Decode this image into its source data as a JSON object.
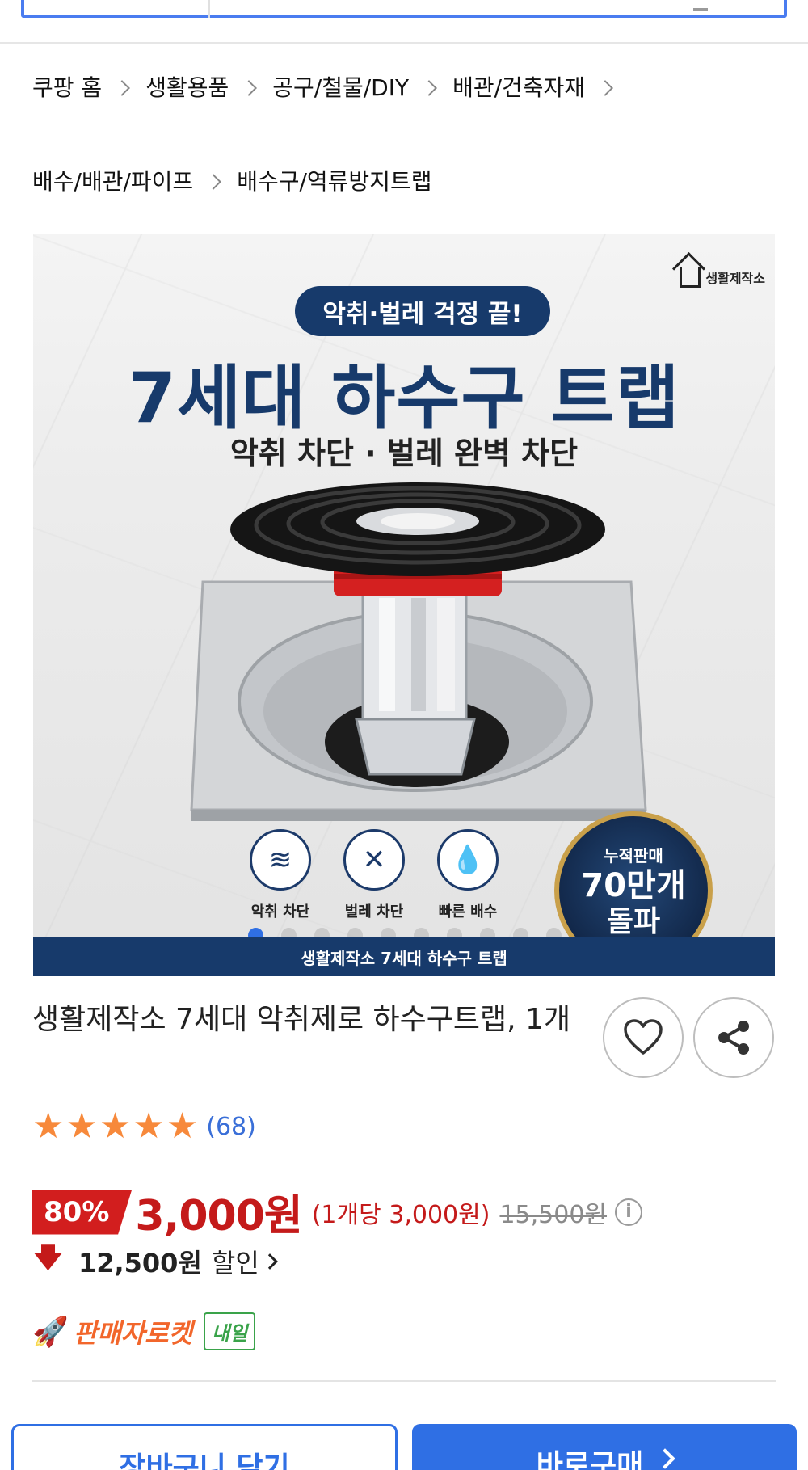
{
  "breadcrumb": {
    "items": [
      "쿠팡 홈",
      "생활용품",
      "공구/철물/DIY",
      "배관/건축자재",
      "배수/배관/파이프",
      "배수구/역류방지트랩"
    ]
  },
  "hero": {
    "brand_logo": "생활제작소",
    "pill": "악취·벌레 걱정 끝!",
    "headline": "7세대 하수구 트랩",
    "subline": "악취 차단 · 벌레 완벽 차단",
    "features": [
      {
        "label": "악취 차단",
        "icon": "odor-icon"
      },
      {
        "label": "벌레 차단",
        "icon": "bug-block-icon"
      },
      {
        "label": "빠른 배수",
        "icon": "water-drop-icon"
      }
    ],
    "seal": {
      "line1": "누적판매",
      "line2": "70만개",
      "line3": "돌파"
    },
    "footer": "생활제작소 7세대 하수구 트랩",
    "carousel": {
      "total": 10,
      "active": 1
    }
  },
  "product": {
    "title": "생활제작소 7세대 악취제로 하수구트랩, 1개"
  },
  "rating": {
    "stars": 5,
    "count": "(68)"
  },
  "price": {
    "discount": "80%",
    "sale": "3,000원",
    "unit": "(1개당 3,000원)",
    "original": "15,500원",
    "info_icon": "i"
  },
  "savings": {
    "amount": "12,500원",
    "label": "할인"
  },
  "delivery": {
    "rocket": "판매자로켓",
    "tomorrow": "내일"
  },
  "buttons": {
    "cart": "장바구니 담기",
    "buy": "바로구매"
  },
  "colors": {
    "accent": "#2f6fe4",
    "price_red": "#c41a1a",
    "navy": "#173a6b",
    "star": "#f7893b",
    "rocket": "#f2662b",
    "tomorrow_green": "#3aa34a"
  }
}
